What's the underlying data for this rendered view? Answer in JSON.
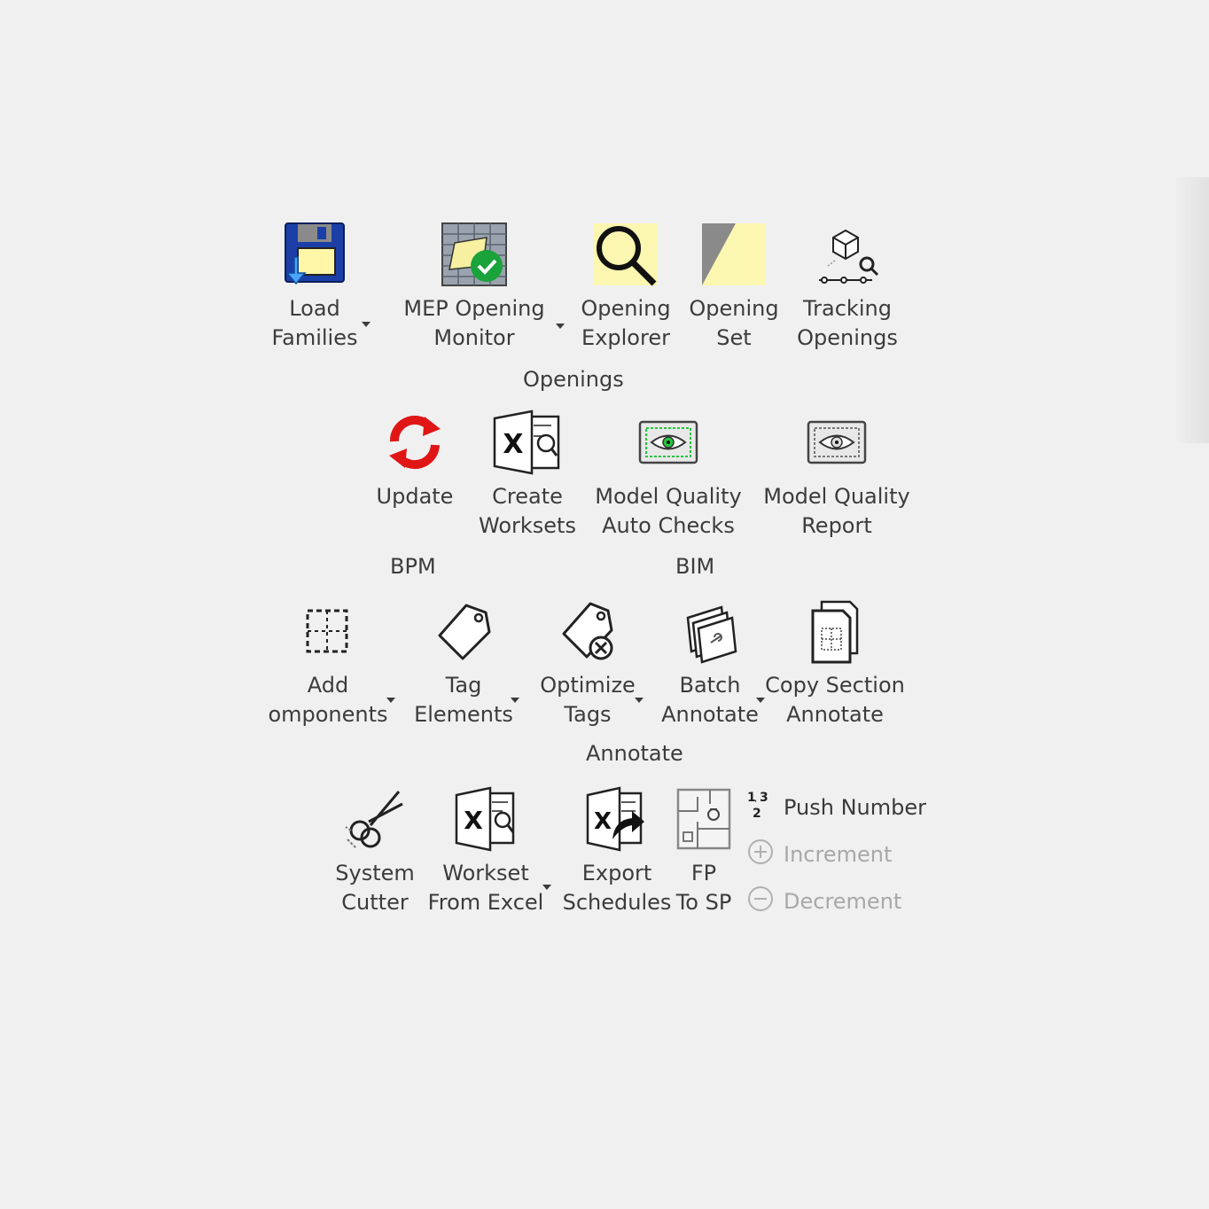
{
  "panels": {
    "openings": {
      "title": "Openings",
      "buttons": [
        {
          "line1": "Load",
          "line2": "Families",
          "icon": "floppy-disk-icon",
          "dropdown": true
        },
        {
          "line1": "MEP Opening",
          "line2": "Monitor",
          "icon": "wall-check-icon",
          "dropdown": true
        },
        {
          "line1": "Opening",
          "line2": "Explorer",
          "icon": "magnifier-icon",
          "dropdown": false
        },
        {
          "line1": "Opening",
          "line2": "Set",
          "icon": "opening-set-icon",
          "dropdown": false
        },
        {
          "line1": "Tracking",
          "line2": "Openings",
          "icon": "tracking-cube-icon",
          "dropdown": false
        }
      ]
    },
    "bpm": {
      "title": "BPM",
      "buttons": [
        {
          "line1": "Update",
          "line2": "",
          "icon": "refresh-icon",
          "dropdown": false
        },
        {
          "line1": "Create",
          "line2": "Worksets",
          "icon": "excel-worksets-icon",
          "dropdown": false
        }
      ]
    },
    "bim": {
      "title": "BIM",
      "buttons": [
        {
          "line1": "Model Quality",
          "line2": "Auto Checks",
          "icon": "eye-green-icon",
          "dropdown": false
        },
        {
          "line1": "Model Quality",
          "line2": "Report",
          "icon": "eye-icon",
          "dropdown": false
        }
      ]
    },
    "annotate": {
      "title": "Annotate",
      "buttons": [
        {
          "line1": "Add",
          "line2": "omponents",
          "icon": "dashed-grid-icon",
          "dropdown": true
        },
        {
          "line1": "Tag",
          "line2": "Elements",
          "icon": "tag-icon",
          "dropdown": true
        },
        {
          "line1": "Optimize",
          "line2": "Tags",
          "icon": "tag-x-icon",
          "dropdown": true
        },
        {
          "line1": "Batch",
          "line2": "Annotate",
          "icon": "batch-sheets-icon",
          "dropdown": true
        },
        {
          "line1": "Copy Section",
          "line2": "Annotate",
          "icon": "copy-section-icon",
          "dropdown": false
        }
      ]
    },
    "tools": {
      "buttons": [
        {
          "line1": "System",
          "line2": "Cutter",
          "icon": "scissors-icon",
          "dropdown": false
        },
        {
          "line1": "Workset",
          "line2": "From Excel",
          "icon": "excel-worksets-icon",
          "dropdown": true
        },
        {
          "line1": "Export",
          "line2": "Schedules",
          "icon": "excel-export-icon",
          "dropdown": false
        },
        {
          "line1": "FP",
          "line2": "To SP",
          "icon": "floorplan-icon",
          "dropdown": false
        }
      ],
      "small": [
        {
          "label": "Push Number",
          "icon": "number-sequence-icon",
          "enabled": true
        },
        {
          "label": "Increment",
          "icon": "plus-circle-icon",
          "enabled": false
        },
        {
          "label": "Decrement",
          "icon": "minus-circle-icon",
          "enabled": false
        }
      ]
    }
  }
}
